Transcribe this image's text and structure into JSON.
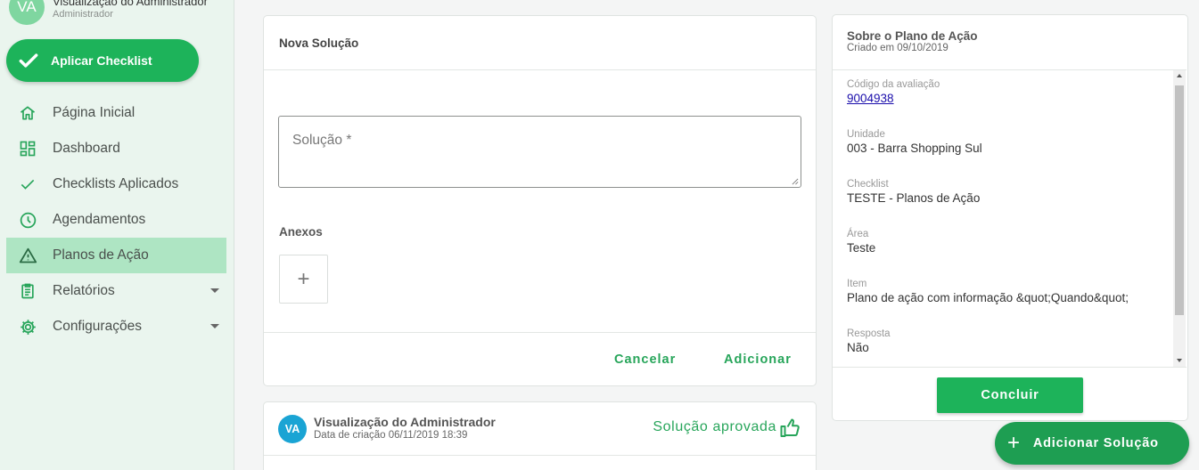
{
  "sidebar": {
    "user": {
      "initials": "VA",
      "name": "Visualização do Administrador",
      "role": "Administrador"
    },
    "apply_button": "Aplicar Checklist",
    "items": [
      {
        "label": "Página Inicial",
        "icon": "home-icon"
      },
      {
        "label": "Dashboard",
        "icon": "dashboard-icon"
      },
      {
        "label": "Checklists Aplicados",
        "icon": "check-icon"
      },
      {
        "label": "Agendamentos",
        "icon": "clock-icon"
      },
      {
        "label": "Planos de Ação",
        "icon": "warning-icon",
        "active": true
      },
      {
        "label": "Relatórios",
        "icon": "clipboard-icon",
        "expandable": true
      },
      {
        "label": "Configurações",
        "icon": "gear-icon",
        "expandable": true
      }
    ]
  },
  "new_solution": {
    "title": "Nova Solução",
    "solution_placeholder": "Solução *",
    "attachments_label": "Anexos",
    "add_attachment": "+",
    "cancel": "Cancelar",
    "add": "Adicionar"
  },
  "comment": {
    "initials": "VA",
    "name": "Visualização do Administrador",
    "date": "Data de criação 06/11/2019 18:39",
    "status": "Solução aprovada"
  },
  "about": {
    "title": "Sobre o Plano de Ação",
    "subtitle": "Criado em 09/10/2019",
    "fields": [
      {
        "label": "Código da avaliação",
        "value": "9004938",
        "link": true
      },
      {
        "label": "Unidade",
        "value": "003 - Barra Shopping Sul"
      },
      {
        "label": "Checklist",
        "value": "TESTE - Planos de Ação"
      },
      {
        "label": "Área",
        "value": "Teste"
      },
      {
        "label": "Item",
        "value": "Plano de ação com informação &quot;Quando&quot;"
      },
      {
        "label": "Resposta",
        "value": "Não"
      }
    ],
    "conclude": "Concluir"
  },
  "fab": {
    "icon": "+",
    "label": "Adicionar Solução"
  },
  "colors": {
    "primary_green": "#1db35a",
    "text_green": "#27a55a",
    "sidebar_bg": "#eaf5ee",
    "active_item_bg": "#aee5c3",
    "avatar_blue": "#1aa4d4"
  }
}
